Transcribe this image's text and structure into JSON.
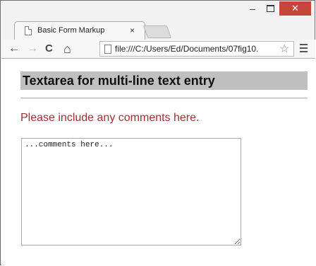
{
  "browser": {
    "tab_title": "Basic Form Markup",
    "tab_close_glyph": "×",
    "min_glyph": "–",
    "close_glyph": "✕",
    "back_glyph": "←",
    "forward_glyph": "→",
    "reload_glyph": "C",
    "home_glyph": "⌂",
    "url": "file:///C:/Users/Ed/Documents/07fig10.",
    "star_glyph": "☆",
    "close_button_color": "#c7463b"
  },
  "page": {
    "heading": "Textarea for multi-line text entry",
    "prompt": "Please include any comments here.",
    "comments_value": "...comments here...",
    "heading_background": "#c0c0c0",
    "prompt_color": "#993333"
  }
}
